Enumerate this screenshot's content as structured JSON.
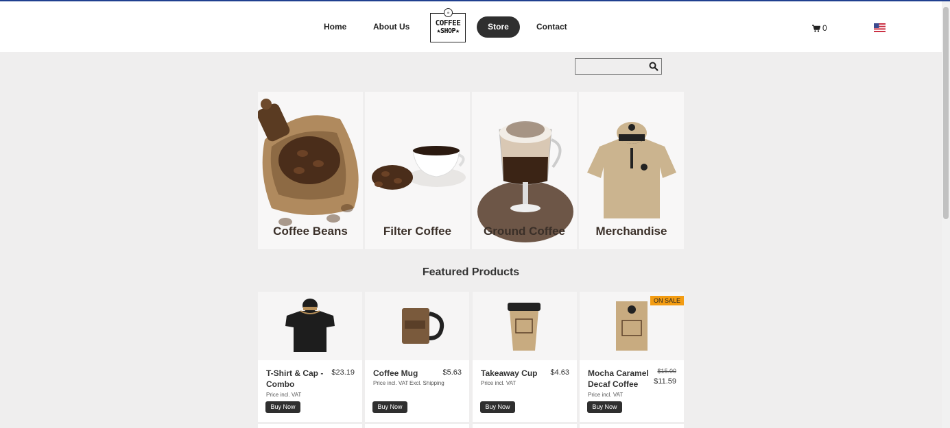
{
  "nav": {
    "home": "Home",
    "about": "About Us",
    "store": "Store",
    "contact": "Contact",
    "logo_line1": "COFFEE",
    "logo_line2": "★SHOP★",
    "cart_count": "0",
    "cart_icon": "cart-icon",
    "flag_icon": "us-flag-icon"
  },
  "search": {
    "value": "",
    "placeholder": "",
    "icon": "search-icon"
  },
  "categories": [
    {
      "label": "Coffee Beans"
    },
    {
      "label": "Filter Coffee"
    },
    {
      "label": "Ground Coffee"
    },
    {
      "label": "Merchandise"
    }
  ],
  "featured": {
    "title": "Featured Products",
    "products": [
      {
        "name": "T-Shirt & Cap - Combo",
        "price": "$23.19",
        "note": "Price incl. VAT",
        "button": "Buy Now"
      },
      {
        "name": "Coffee Mug",
        "price": "$5.63",
        "note": "Price incl. VAT",
        "note2": "Excl. Shipping",
        "button": "Buy Now"
      },
      {
        "name": "Takeaway Cup",
        "price": "$4.63",
        "note": "Price incl. VAT",
        "button": "Buy Now"
      },
      {
        "name": "Mocha Caramel Decaf Coffee",
        "old_price": "$15.00",
        "price": "$11.59",
        "note": "Price incl. VAT",
        "button": "Buy Now",
        "badge": "ON SALE"
      }
    ]
  },
  "colors": {
    "accent": "#2f2f2f",
    "sale": "#f39c12",
    "topline": "#1f3f8f"
  }
}
